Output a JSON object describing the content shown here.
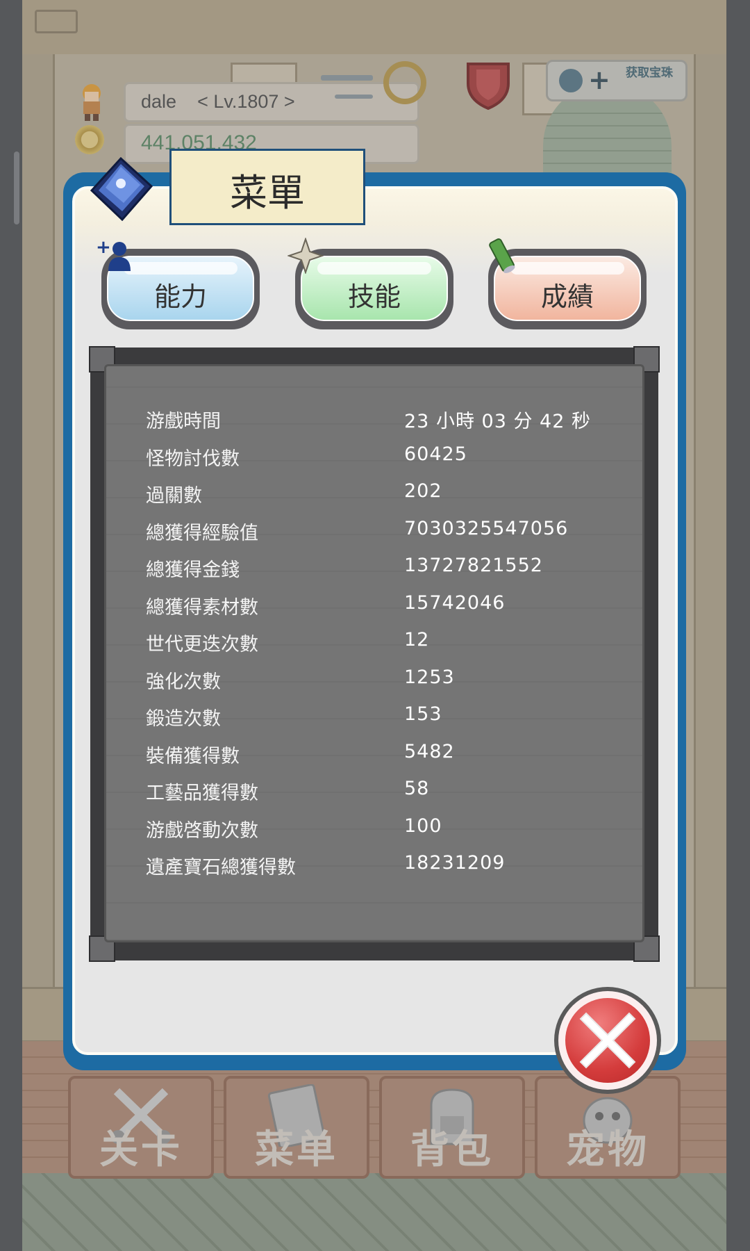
{
  "hud": {
    "player_name": "dale",
    "level": "< Lv.1807 >",
    "gold": "441,051,432",
    "get_gem_label": "获取宝珠"
  },
  "dialog": {
    "title": "菜單",
    "tabs": [
      {
        "label": "能力",
        "icon": "add-person-icon"
      },
      {
        "label": "技能",
        "icon": "sparkle-icon"
      },
      {
        "label": "成績",
        "icon": "scroll-icon"
      }
    ],
    "active_tab": "成績",
    "stats": [
      {
        "key": "游戲時間",
        "value": "23 小時 03 分 42 秒"
      },
      {
        "key": "怪物討伐數",
        "value": "60425"
      },
      {
        "key": "過關數",
        "value": "202"
      },
      {
        "key": "總獲得經驗值",
        "value": "7030325547056"
      },
      {
        "key": "總獲得金錢",
        "value": "13727821552"
      },
      {
        "key": "總獲得素材數",
        "value": "15742046"
      },
      {
        "key": "世代更迭次數",
        "value": "12"
      },
      {
        "key": "強化次數",
        "value": "1253"
      },
      {
        "key": "鍛造次數",
        "value": "153"
      },
      {
        "key": "裝備獲得數",
        "value": "5482"
      },
      {
        "key": "工藝品獲得數",
        "value": "58"
      },
      {
        "key": "游戲啓動次數",
        "value": "100"
      },
      {
        "key": "遺產寶石總獲得數",
        "value": "18231209"
      }
    ]
  },
  "bottom_nav": [
    {
      "label": "关卡",
      "icon": "crossed-swords-icon"
    },
    {
      "label": "菜单",
      "icon": "book-icon"
    },
    {
      "label": "背包",
      "icon": "backpack-icon"
    },
    {
      "label": "宠物",
      "icon": "pet-icon"
    }
  ],
  "colors": {
    "dialog_border": "#1d6ba3",
    "panel_bg": "#757575",
    "close_red": "#d43c3c"
  }
}
